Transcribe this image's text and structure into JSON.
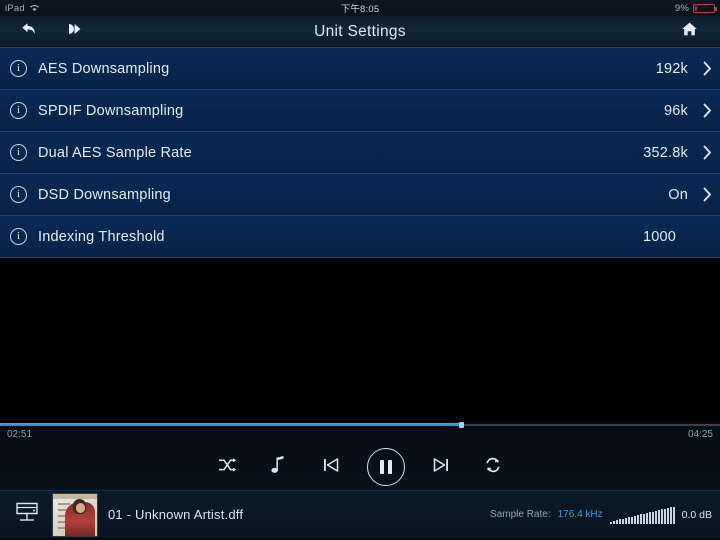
{
  "status_bar": {
    "carrier": "iPad",
    "wifi_icon": "wifi-icon",
    "time": "下午8:05",
    "battery_percent": "9%",
    "battery_level": 9,
    "battery_color": "#c0333d"
  },
  "nav_bar": {
    "title": "Unit Settings",
    "back_icon": "back-arrow-icon",
    "forward_icon": "fast-forward-icon",
    "home_icon": "home-icon"
  },
  "settings": {
    "rows": [
      {
        "info_icon": "info-icon",
        "label": "AES Downsampling",
        "value": "192k",
        "has_chevron": true
      },
      {
        "info_icon": "info-icon",
        "label": "SPDIF Downsampling",
        "value": "96k",
        "has_chevron": true
      },
      {
        "info_icon": "info-icon",
        "label": "Dual AES Sample Rate",
        "value": "352.8k",
        "has_chevron": true
      },
      {
        "info_icon": "info-icon",
        "label": "DSD Downsampling",
        "value": "On",
        "has_chevron": true
      },
      {
        "info_icon": "info-icon",
        "label": "Indexing Threshold",
        "value": "1000",
        "has_chevron": false
      }
    ]
  },
  "player": {
    "elapsed": "02:51",
    "remaining": "04:25",
    "progress_percent": 64,
    "progress_color": "#1f86d6",
    "controls": {
      "shuffle": "shuffle-icon",
      "music_note": "music-note-icon",
      "previous": "previous-track-icon",
      "pause": "pause-icon",
      "next": "next-track-icon",
      "repeat": "repeat-icon"
    }
  },
  "bottom_bar": {
    "monitor_icon": "monitor-icon",
    "album_art": "album-artwork",
    "track_title": "01 - Unknown Artist.dff",
    "sample_rate_label": "Sample Rate:",
    "sample_rate_value": "176.4 kHz",
    "sample_rate_color": "#4f9ad6",
    "volume_icon": "volume-level-icon",
    "volume_db": "0.0 dB"
  }
}
